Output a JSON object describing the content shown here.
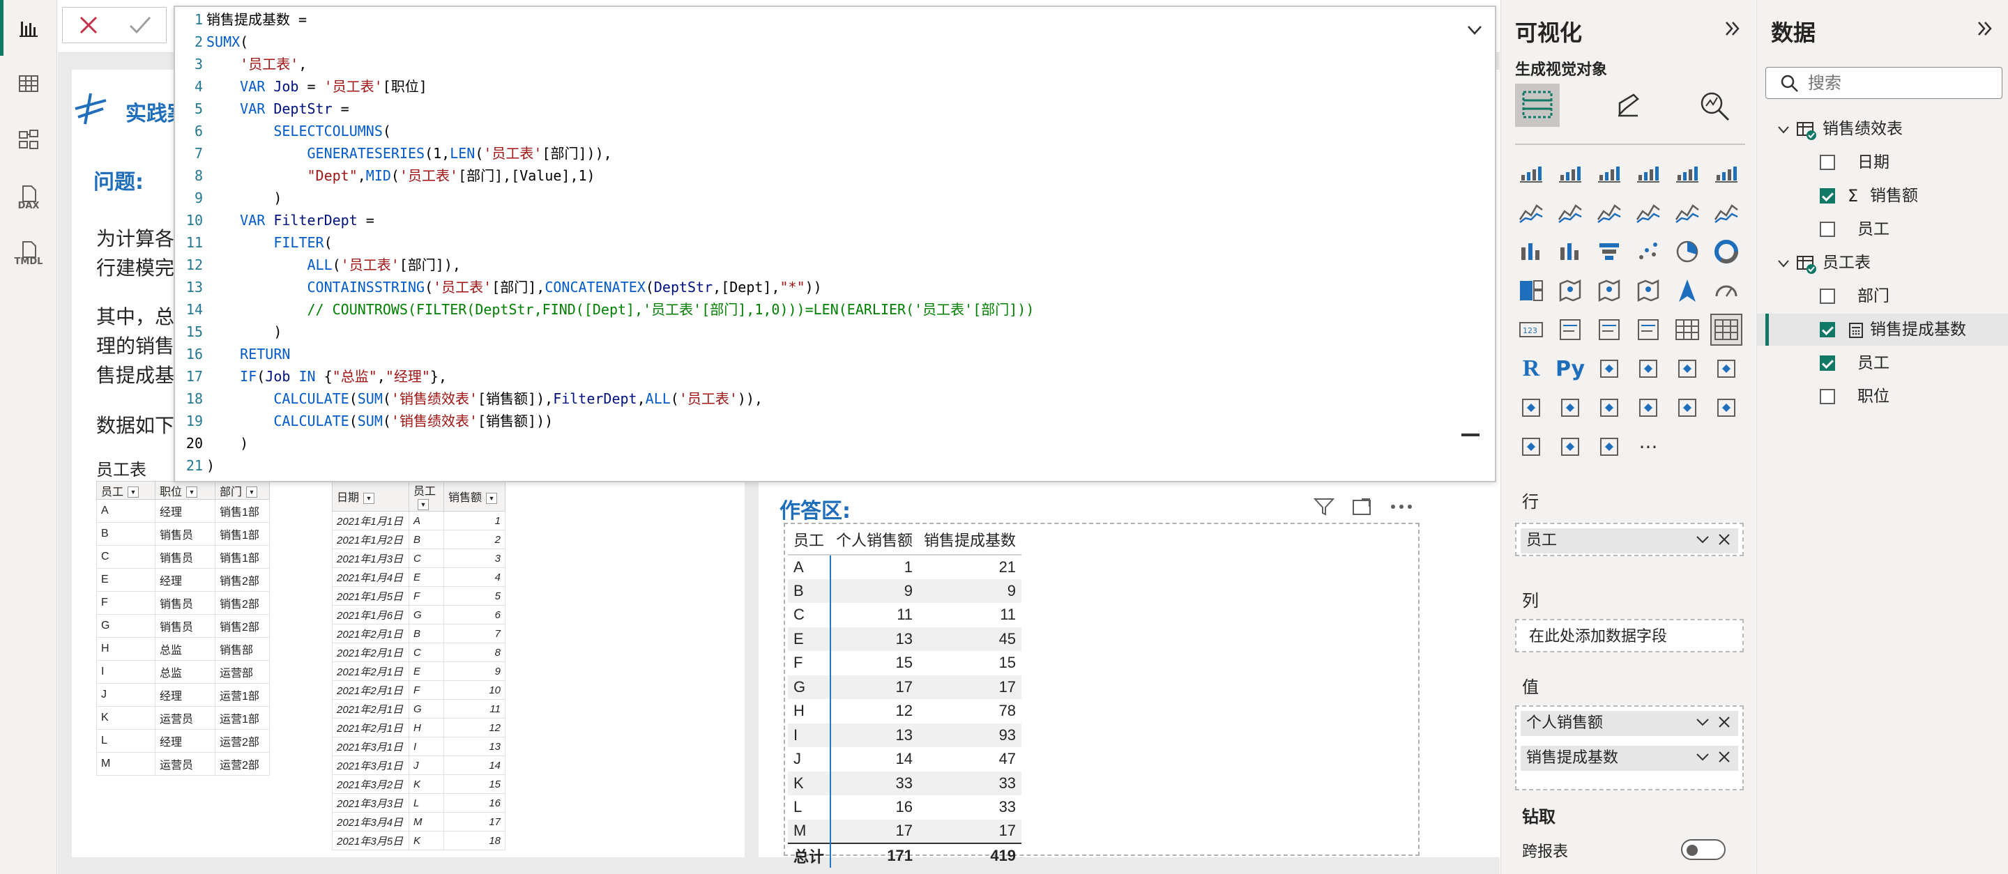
{
  "nav": {
    "items": [
      "report-view",
      "table-view",
      "model-view",
      "dax-query-view",
      "tmdl-view"
    ],
    "dax_label": "DAX",
    "tmdl_label": "TMDL"
  },
  "formula": {
    "lines": [
      "销售提成基数 =",
      "SUMX(",
      "    '员工表',",
      "    VAR Job = '员工表'[职位]",
      "    VAR DeptStr =",
      "        SELECTCOLUMNS(",
      "            GENERATESERIES(1,LEN('员工表'[部门])),",
      "            \"Dept\",MID('员工表'[部门],[Value],1)",
      "        )",
      "    VAR FilterDept =",
      "        FILTER(",
      "            ALL('员工表'[部门]),",
      "            CONTAINSSTRING('员工表'[部门],CONCATENATEX(DeptStr,[Dept],\"*\"))",
      "            // COUNTROWS(FILTER(DeptStr,FIND([Dept],'员工表'[部门],1,0)))=LEN(EARLIER('员工表'[部门]))",
      "        )",
      "    RETURN",
      "    IF(Job IN {\"总监\",\"经理\"},",
      "        CALCULATE(SUM('销售绩效表'[销售额]),FilterDept,ALL('员工表')),",
      "        CALCULATE(SUM('销售绩效表'[销售额]))",
      "    )",
      ")"
    ]
  },
  "page": {
    "title": "实践案",
    "question_label": "问题:",
    "para1": [
      "为计算各",
      "行建模完"
    ],
    "para2": [
      "其中，总",
      "理的销售",
      "售提成基"
    ],
    "para3": "数据如下",
    "employee_caption": "员工表",
    "answer_title": "作答区:"
  },
  "employee_table": {
    "headers": [
      "员工",
      "职位",
      "部门"
    ],
    "rows": [
      [
        "A",
        "经理",
        "销售1部"
      ],
      [
        "B",
        "销售员",
        "销售1部"
      ],
      [
        "C",
        "销售员",
        "销售1部"
      ],
      [
        "E",
        "经理",
        "销售2部"
      ],
      [
        "F",
        "销售员",
        "销售2部"
      ],
      [
        "G",
        "销售员",
        "销售2部"
      ],
      [
        "H",
        "总监",
        "销售部"
      ],
      [
        "I",
        "总监",
        "运营部"
      ],
      [
        "J",
        "经理",
        "运营1部"
      ],
      [
        "K",
        "运营员",
        "运营1部"
      ],
      [
        "L",
        "经理",
        "运营2部"
      ],
      [
        "M",
        "运营员",
        "运营2部"
      ]
    ]
  },
  "sales_table": {
    "headers": [
      "日期",
      "员工",
      "销售额"
    ],
    "rows": [
      [
        "2021年1月1日",
        "A",
        "1"
      ],
      [
        "2021年1月2日",
        "B",
        "2"
      ],
      [
        "2021年1月3日",
        "C",
        "3"
      ],
      [
        "2021年1月4日",
        "E",
        "4"
      ],
      [
        "2021年1月5日",
        "F",
        "5"
      ],
      [
        "2021年1月6日",
        "G",
        "6"
      ],
      [
        "2021年2月1日",
        "B",
        "7"
      ],
      [
        "2021年2月1日",
        "C",
        "8"
      ],
      [
        "2021年2月1日",
        "E",
        "9"
      ],
      [
        "2021年2月1日",
        "F",
        "10"
      ],
      [
        "2021年2月1日",
        "G",
        "11"
      ],
      [
        "2021年2月1日",
        "H",
        "12"
      ],
      [
        "2021年3月1日",
        "I",
        "13"
      ],
      [
        "2021年3月1日",
        "J",
        "14"
      ],
      [
        "2021年3月2日",
        "K",
        "15"
      ],
      [
        "2021年3月3日",
        "L",
        "16"
      ],
      [
        "2021年3月4日",
        "M",
        "17"
      ],
      [
        "2021年3月5日",
        "K",
        "18"
      ]
    ]
  },
  "matrix": {
    "headers": [
      "员工",
      "个人销售额",
      "销售提成基数"
    ],
    "rows": [
      [
        "A",
        "1",
        "21"
      ],
      [
        "B",
        "9",
        "9"
      ],
      [
        "C",
        "11",
        "11"
      ],
      [
        "E",
        "13",
        "45"
      ],
      [
        "F",
        "15",
        "15"
      ],
      [
        "G",
        "17",
        "17"
      ],
      [
        "H",
        "12",
        "78"
      ],
      [
        "I",
        "13",
        "93"
      ],
      [
        "J",
        "14",
        "47"
      ],
      [
        "K",
        "33",
        "33"
      ],
      [
        "L",
        "16",
        "33"
      ],
      [
        "M",
        "17",
        "17"
      ]
    ],
    "total": [
      "总计",
      "171",
      "419"
    ]
  },
  "viz_pane": {
    "title": "可视化",
    "build_label": "生成视觉对象",
    "rows_label": "行",
    "rows_field": "员工",
    "cols_label": "列",
    "cols_placeholder": "在此处添加数据字段",
    "values_label": "值",
    "value_fields": [
      "个人销售额",
      "销售提成基数"
    ],
    "drill_label": "钻取",
    "cross_report_label": "跨报表",
    "cross_report_state": "off",
    "python_label": "Py",
    "r_label": "R",
    "more_label": "···"
  },
  "data_pane": {
    "title": "数据",
    "search_placeholder": "搜索",
    "tables": [
      {
        "name": "销售绩效表",
        "fields": [
          {
            "name": "日期",
            "checked": false
          },
          {
            "name": "销售额",
            "checked": true,
            "sigma": true
          },
          {
            "name": "员工",
            "checked": false
          }
        ]
      },
      {
        "name": "员工表",
        "fields": [
          {
            "name": "部门",
            "checked": false
          },
          {
            "name": "销售提成基数",
            "checked": true,
            "measure": true,
            "selected": true
          },
          {
            "name": "员工",
            "checked": true
          },
          {
            "name": "职位",
            "checked": false
          }
        ]
      }
    ]
  },
  "colors": {
    "accent": "#117865",
    "title_blue": "#1f6ebc",
    "keyword": "#035aca",
    "string": "#a31515",
    "comment": "#008000"
  }
}
